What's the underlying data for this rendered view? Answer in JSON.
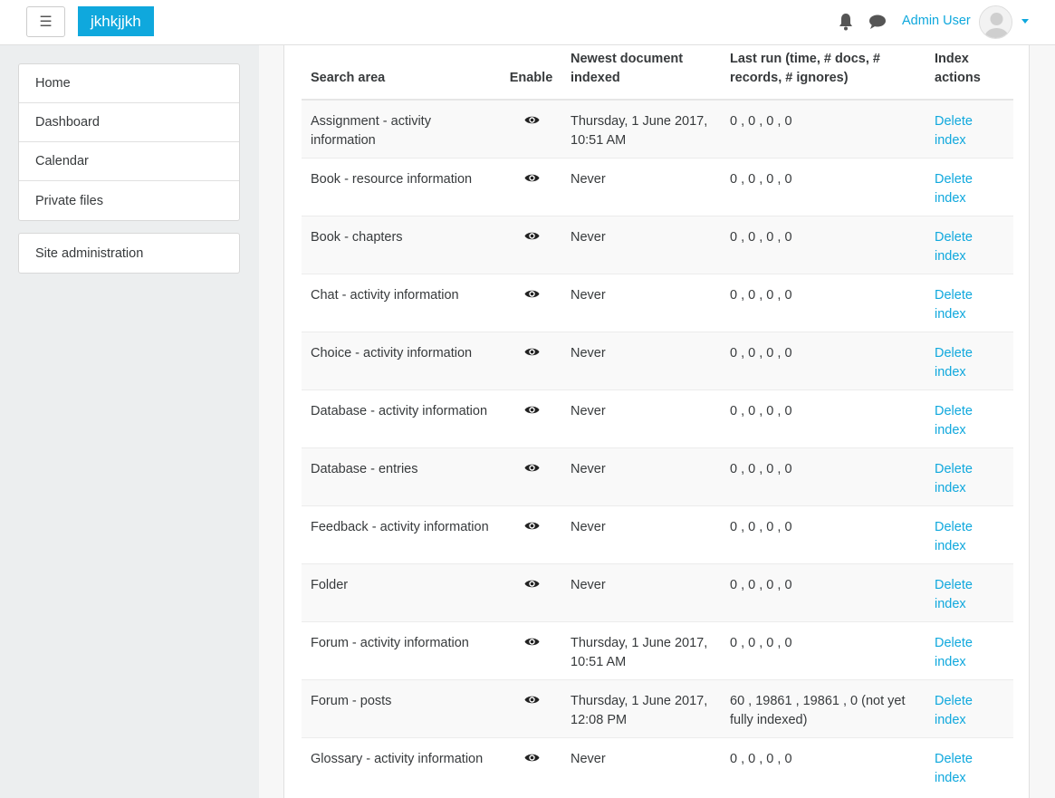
{
  "navbar": {
    "menu_icon": "hamburger-icon",
    "brand": "jkhkjjkh",
    "notifications_icon": "bell-icon",
    "messages_icon": "chat-icon",
    "user_name": "Admin User",
    "accent_color": "#0fa8dd"
  },
  "sidebar": {
    "items": [
      {
        "label": "Home"
      },
      {
        "label": "Dashboard"
      },
      {
        "label": "Calendar"
      },
      {
        "label": "Private files"
      }
    ],
    "admin": {
      "label": "Site administration"
    }
  },
  "table": {
    "headers": {
      "area": "Search area",
      "enable": "Enable",
      "newest": "Newest document indexed",
      "last_run": "Last run (time, # docs, # records, # ignores)",
      "actions": "Index actions"
    },
    "rows": [
      {
        "area": "Assignment - activity information",
        "newest": "Thursday, 1 June 2017, 10:51 AM",
        "last_run": "0 , 0 , 0 , 0",
        "action": "Delete index"
      },
      {
        "area": "Book - resource information",
        "newest": "Never",
        "last_run": "0 , 0 , 0 , 0",
        "action": "Delete index"
      },
      {
        "area": "Book - chapters",
        "newest": "Never",
        "last_run": "0 , 0 , 0 , 0",
        "action": "Delete index"
      },
      {
        "area": "Chat - activity information",
        "newest": "Never",
        "last_run": "0 , 0 , 0 , 0",
        "action": "Delete index"
      },
      {
        "area": "Choice - activity information",
        "newest": "Never",
        "last_run": "0 , 0 , 0 , 0",
        "action": "Delete index"
      },
      {
        "area": "Database - activity information",
        "newest": "Never",
        "last_run": "0 , 0 , 0 , 0",
        "action": "Delete index"
      },
      {
        "area": "Database - entries",
        "newest": "Never",
        "last_run": "0 , 0 , 0 , 0",
        "action": "Delete index"
      },
      {
        "area": "Feedback - activity information",
        "newest": "Never",
        "last_run": "0 , 0 , 0 , 0",
        "action": "Delete index"
      },
      {
        "area": "Folder",
        "newest": "Never",
        "last_run": "0 , 0 , 0 , 0",
        "action": "Delete index"
      },
      {
        "area": "Forum - activity information",
        "newest": "Thursday, 1 June 2017, 10:51 AM",
        "last_run": "0 , 0 , 0 , 0",
        "action": "Delete index"
      },
      {
        "area": "Forum - posts",
        "newest": "Thursday, 1 June 2017, 12:08 PM",
        "last_run": "60 , 19861 , 19861 , 0 (not yet fully indexed)",
        "action": "Delete index"
      },
      {
        "area": "Glossary - activity information",
        "newest": "Never",
        "last_run": "0 , 0 , 0 , 0",
        "action": "Delete index"
      }
    ],
    "enable_icon": "eye-icon"
  }
}
